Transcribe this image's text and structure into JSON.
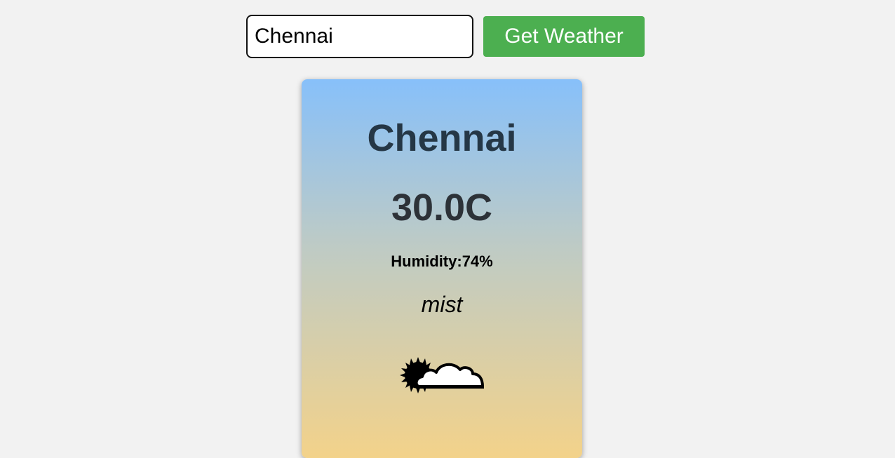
{
  "search": {
    "value": "Chennai",
    "button_label": "Get Weather"
  },
  "weather": {
    "city": "Chennai",
    "temperature": "30.0C",
    "humidity": "Humidity:74%",
    "description": "mist",
    "icon": "partly-cloudy-icon"
  },
  "colors": {
    "button": "#4caf50",
    "card_gradient_top": "#87c0fa",
    "card_gradient_bottom": "#f3d28a",
    "city_text": "#253746"
  }
}
